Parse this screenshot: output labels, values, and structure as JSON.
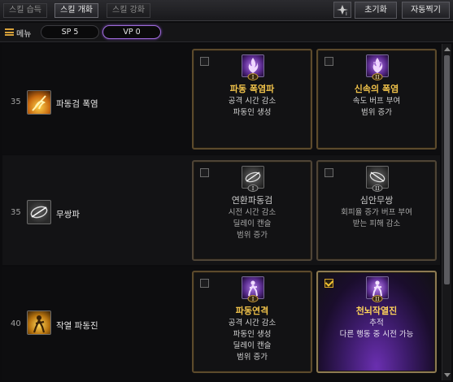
{
  "tabs": [
    {
      "label": "스킬 습득",
      "active": false
    },
    {
      "label": "스킬 개화",
      "active": true
    },
    {
      "label": "스킬 강화",
      "active": false
    }
  ],
  "toolbar": {
    "reset_label": "초기화",
    "auto_label": "자동찍기"
  },
  "info": {
    "menu_label": "메뉴",
    "sp": "SP 5",
    "vp": "VP 0"
  },
  "skills": [
    {
      "level": "35",
      "name": "파동검 폭염",
      "options": [
        {
          "title": "파동 폭염파",
          "desc": [
            "공격 시간 감소",
            "파동인 생성"
          ],
          "badge": "I",
          "selected": false,
          "enabled": true
        },
        {
          "title": "신속의 폭염",
          "desc": [
            "속도 버프 부여",
            "범위 증가"
          ],
          "badge": "II",
          "selected": false,
          "enabled": true
        }
      ]
    },
    {
      "level": "35",
      "name": "무쌍파",
      "options": [
        {
          "title": "연환파동검",
          "desc": [
            "시전 시간 감소",
            "딜레이 캔슬",
            "범위 증가"
          ],
          "badge": "I",
          "selected": false,
          "enabled": false
        },
        {
          "title": "심안무쌍",
          "desc": [
            "회피율 증가 버프 부여",
            "받는 피해 감소"
          ],
          "badge": "II",
          "selected": false,
          "enabled": false
        }
      ]
    },
    {
      "level": "40",
      "name": "작열 파동진",
      "options": [
        {
          "title": "파동연격",
          "desc": [
            "공격 시간 감소",
            "파동인 생성",
            "딜레이 캔슬",
            "범위 증가"
          ],
          "badge": "I",
          "selected": false,
          "enabled": true
        },
        {
          "title": "천뇌작열진",
          "desc": [
            "추적",
            "다른 행동 중 시전 가능"
          ],
          "badge": "II",
          "selected": true,
          "enabled": true
        }
      ]
    }
  ]
}
